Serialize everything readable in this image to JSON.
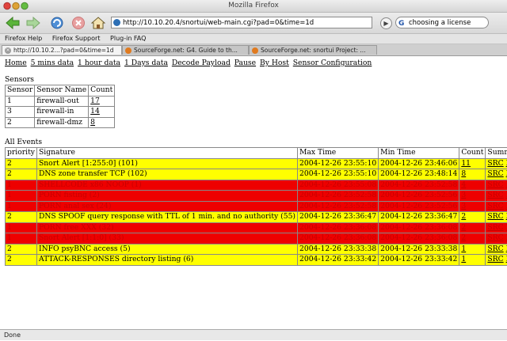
{
  "window": {
    "title": "Mozilla Firefox"
  },
  "toolbar": {
    "url": "http://10.10.20.4/snortui/web-main.cgi?pad=0&time=1d",
    "search_value": "choosing a license",
    "search_engine_letter": "G"
  },
  "bookmarks": [
    "Firefox Help",
    "Firefox Support",
    "Plug-in FAQ"
  ],
  "tabs": [
    {
      "label": "http://10.10.2...?pad=0&time=1d",
      "active": true
    },
    {
      "label": "SourceForge.net: G4. Guide to th...",
      "active": false
    },
    {
      "label": "SourceForge.net: snortui Project: ...",
      "active": false
    }
  ],
  "nav_links": [
    "Home",
    "5 mins data",
    "1 hour data",
    "1 Days data",
    "Decode Payload",
    "Pause",
    "By Host",
    "Sensor Configuration"
  ],
  "sensors": {
    "title": "Sensors",
    "headers": [
      "Sensor",
      "Sensor Name",
      "Count"
    ],
    "rows": [
      [
        "1",
        "firewall-out",
        "17"
      ],
      [
        "3",
        "firewall-in",
        "14"
      ],
      [
        "2",
        "firewall-dmz",
        "8"
      ]
    ]
  },
  "events": {
    "title": "All Events",
    "headers": [
      "priority",
      "Signature",
      "Max Time",
      "Min Time",
      "Count",
      "Summary"
    ],
    "src_label": "SRC",
    "dst_label": "DST",
    "rows": [
      {
        "color": "yellow",
        "priority": "2",
        "signature": "Snort Alert [1:255:0] (101)",
        "max": "2004-12-26 23:55:10",
        "min": "2004-12-26 23:46:06",
        "count": "11"
      },
      {
        "color": "yellow",
        "priority": "2",
        "signature": "DNS zone transfer TCP (102)",
        "max": "2004-12-26 23:55:10",
        "min": "2004-12-26 23:48:14",
        "count": "8"
      },
      {
        "color": "red",
        "priority": "1",
        "signature": "SHELLCODE x86 NOOP (1)",
        "max": "2004-12-26 23:55:08",
        "min": "2004-12-26 23:52:58",
        "count": "4"
      },
      {
        "color": "red",
        "priority": "1",
        "signature": "PORN fisting (2)",
        "max": "2004-12-26 23:52:58",
        "min": "2004-12-26 23:52:56",
        "count": "3"
      },
      {
        "color": "red",
        "priority": "1",
        "signature": "PORN anal sex (24)",
        "max": "2004-12-26 23:52:58",
        "min": "2004-12-26 23:52:56",
        "count": "3"
      },
      {
        "color": "yellow",
        "priority": "2",
        "signature": "DNS SPOOF query response with TTL of 1 min. and no authority (55)",
        "max": "2004-12-26 23:36:47",
        "min": "2004-12-26 23:36:47",
        "count": "2"
      },
      {
        "color": "red",
        "priority": "1",
        "signature": "PORN free XXX (32)",
        "max": "2004-12-26 23:36:08",
        "min": "2004-12-26 23:36:08",
        "count": "2"
      },
      {
        "color": "red",
        "priority": "1",
        "signature": "Snort Alert [1:1:0] (33)",
        "max": "2004-12-26 23:36:08",
        "min": "2004-12-26 23:36:08",
        "count": "2"
      },
      {
        "color": "yellow",
        "priority": "2",
        "signature": "INFO psyBNC access (5)",
        "max": "2004-12-26 23:33:38",
        "min": "2004-12-26 23:33:38",
        "count": "1"
      },
      {
        "color": "yellow",
        "priority": "2",
        "signature": "ATTACK-RESPONSES directory listing (6)",
        "max": "2004-12-26 23:33:42",
        "min": "2004-12-26 23:33:42",
        "count": "1"
      }
    ]
  },
  "status": {
    "text": "Done"
  },
  "colors": {
    "yellow": "#ffff00",
    "red": "#ee0000"
  }
}
